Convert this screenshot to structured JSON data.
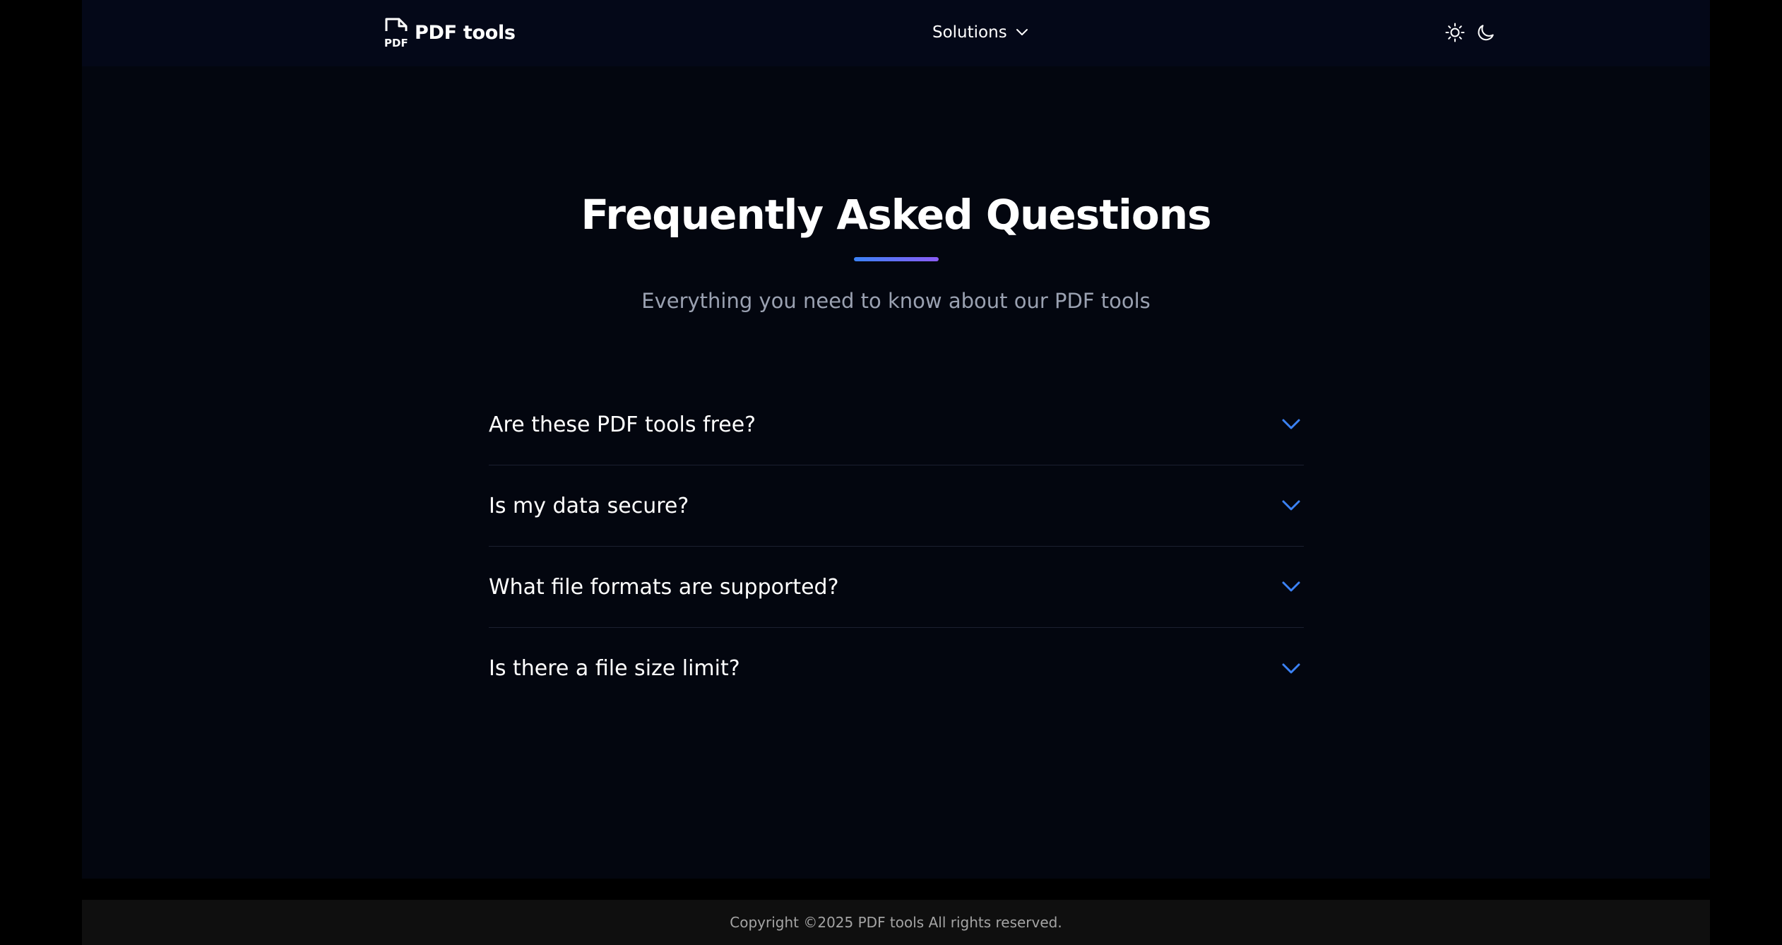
{
  "navbar": {
    "brand": "PDF tools",
    "logo_icon": "pdf-file-icon",
    "solutions_label": "Solutions",
    "solutions_icon": "chevron-down-icon",
    "theme_light_icon": "sun-icon",
    "theme_dark_icon": "moon-icon"
  },
  "hero": {
    "title": "Frequently Asked Questions",
    "subtitle": "Everything you need to know about our PDF tools"
  },
  "faq": {
    "items": [
      {
        "question": "Are these PDF tools free?"
      },
      {
        "question": "Is my data secure?"
      },
      {
        "question": "What file formats are supported?"
      },
      {
        "question": "Is there a file size limit?"
      }
    ],
    "chevron_icon": "chevron-down-icon"
  },
  "footer": {
    "copyright": "Copyright ©2025 PDF tools All rights reserved."
  },
  "colors": {
    "background": "#03060f",
    "navbar": "#040818",
    "accent_blue": "#3b82f6",
    "accent_purple": "#8b5cf6",
    "subtitle_gray": "#9aa1b1",
    "footer_bg": "#0f0f0f"
  }
}
